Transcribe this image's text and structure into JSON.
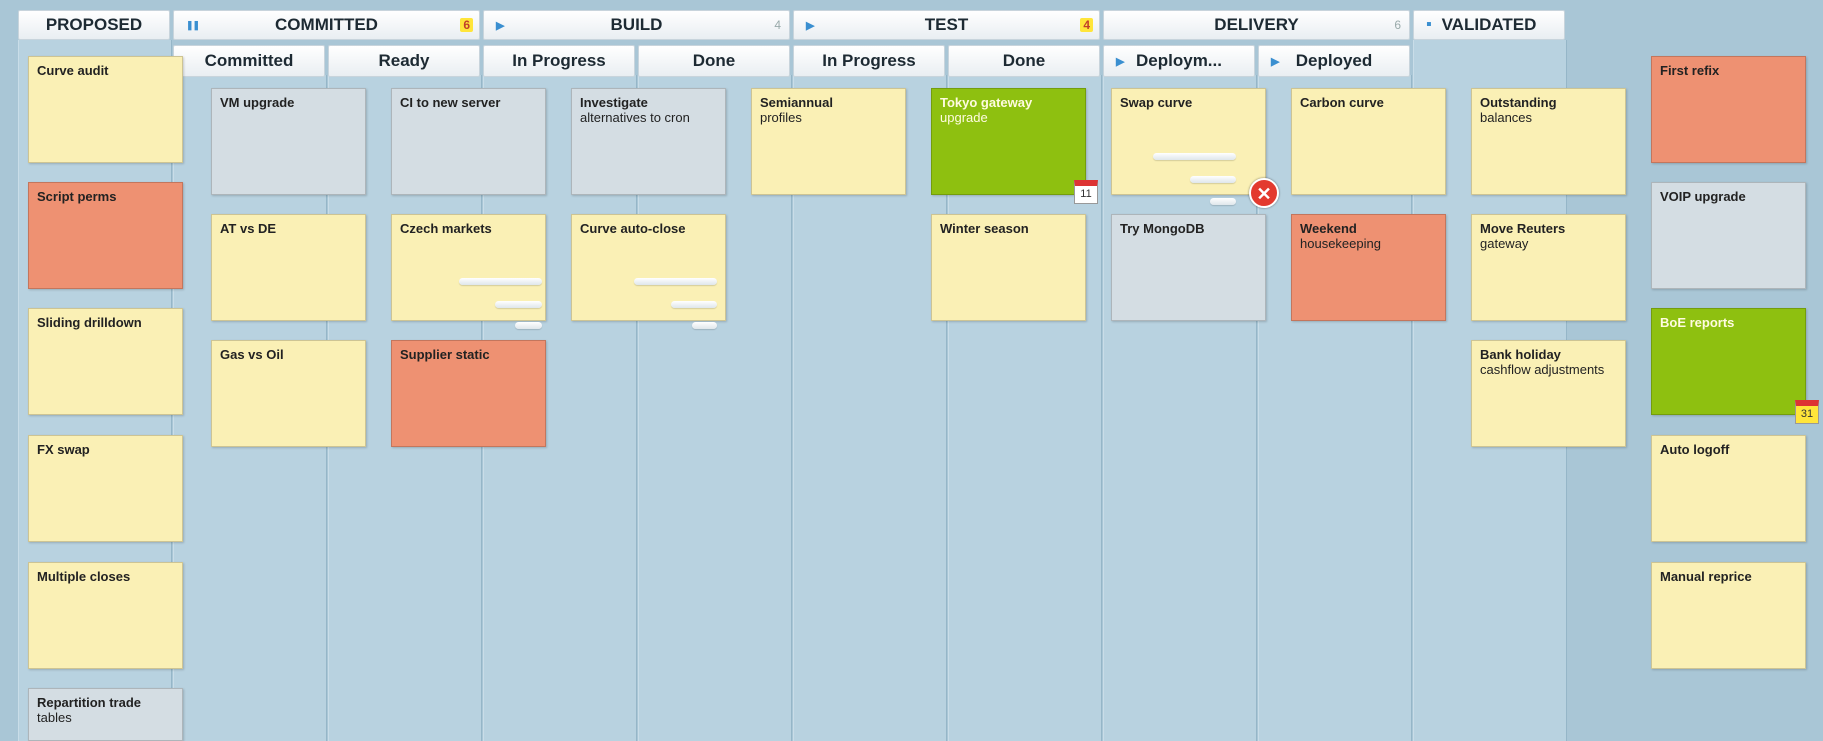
{
  "stages": {
    "proposed": {
      "label": "PROPOSED"
    },
    "committed": {
      "label": "COMMITTED",
      "count": "6"
    },
    "build": {
      "label": "BUILD",
      "count": "4"
    },
    "test": {
      "label": "TEST",
      "count": "4"
    },
    "delivery": {
      "label": "DELIVERY",
      "count": "6"
    },
    "validated": {
      "label": "VALIDATED"
    }
  },
  "subcolumns": {
    "committed": "Committed",
    "ready": "Ready",
    "build_in_progress": "In Progress",
    "build_done": "Done",
    "test_in_progress": "In Progress",
    "test_done": "Done",
    "deployment": "Deploym...",
    "deployed": "Deployed"
  },
  "cards": {
    "curve_audit": {
      "title": "Curve audit"
    },
    "script_perms": {
      "title": "Script perms"
    },
    "sliding_drilldown": {
      "title": "Sliding drilldown"
    },
    "fx_swap": {
      "title": "FX swap"
    },
    "multiple_closes": {
      "title": "Multiple closes"
    },
    "repartition": {
      "title": "Repartition trade",
      "sub": "tables"
    },
    "vm_upgrade": {
      "title": "VM upgrade"
    },
    "at_vs_de": {
      "title": "AT vs DE"
    },
    "gas_vs_oil": {
      "title": "Gas vs Oil"
    },
    "ci_new_server": {
      "title": "CI to new server"
    },
    "czech_markets": {
      "title": "Czech markets"
    },
    "supplier_static": {
      "title": "Supplier static"
    },
    "investigate": {
      "title": "Investigate",
      "sub": "alternatives to cron"
    },
    "curve_auto_close": {
      "title": "Curve auto-close"
    },
    "semiannual": {
      "title": "Semiannual",
      "sub": "profiles"
    },
    "tokyo_gateway": {
      "title": "Tokyo gateway",
      "sub": "upgrade",
      "date": "11"
    },
    "winter_season": {
      "title": "Winter season"
    },
    "swap_curve": {
      "title": "Swap curve"
    },
    "try_mongodb": {
      "title": "Try MongoDB"
    },
    "carbon_curve": {
      "title": "Carbon curve"
    },
    "weekend": {
      "title": "Weekend",
      "sub": "housekeeping"
    },
    "outstanding": {
      "title": "Outstanding",
      "sub": "balances"
    },
    "move_reuters": {
      "title": "Move Reuters",
      "sub": "gateway"
    },
    "bank_holiday": {
      "title": "Bank holiday",
      "sub": "cashflow adjustments"
    },
    "first_refix": {
      "title": "First refix"
    },
    "voip_upgrade": {
      "title": "VOIP upgrade"
    },
    "boe_reports": {
      "title": "BoE reports",
      "date": "31"
    },
    "auto_logoff": {
      "title": "Auto logoff"
    },
    "manual_reprice": {
      "title": "Manual reprice"
    }
  },
  "icons": {
    "stage_arrow": "play-triangle-icon",
    "stage_pause": "pause-icon",
    "validated_bullet": "bullet-icon",
    "calendar": "calendar-icon",
    "remove": "close-x-icon"
  },
  "colors": {
    "background": "#a9c6d6",
    "card_yellow": "#faf0b5",
    "card_grey": "#d4dde3",
    "card_red": "#ee9172",
    "card_green": "#8ec010",
    "warning_badge": "#ffe53a"
  }
}
